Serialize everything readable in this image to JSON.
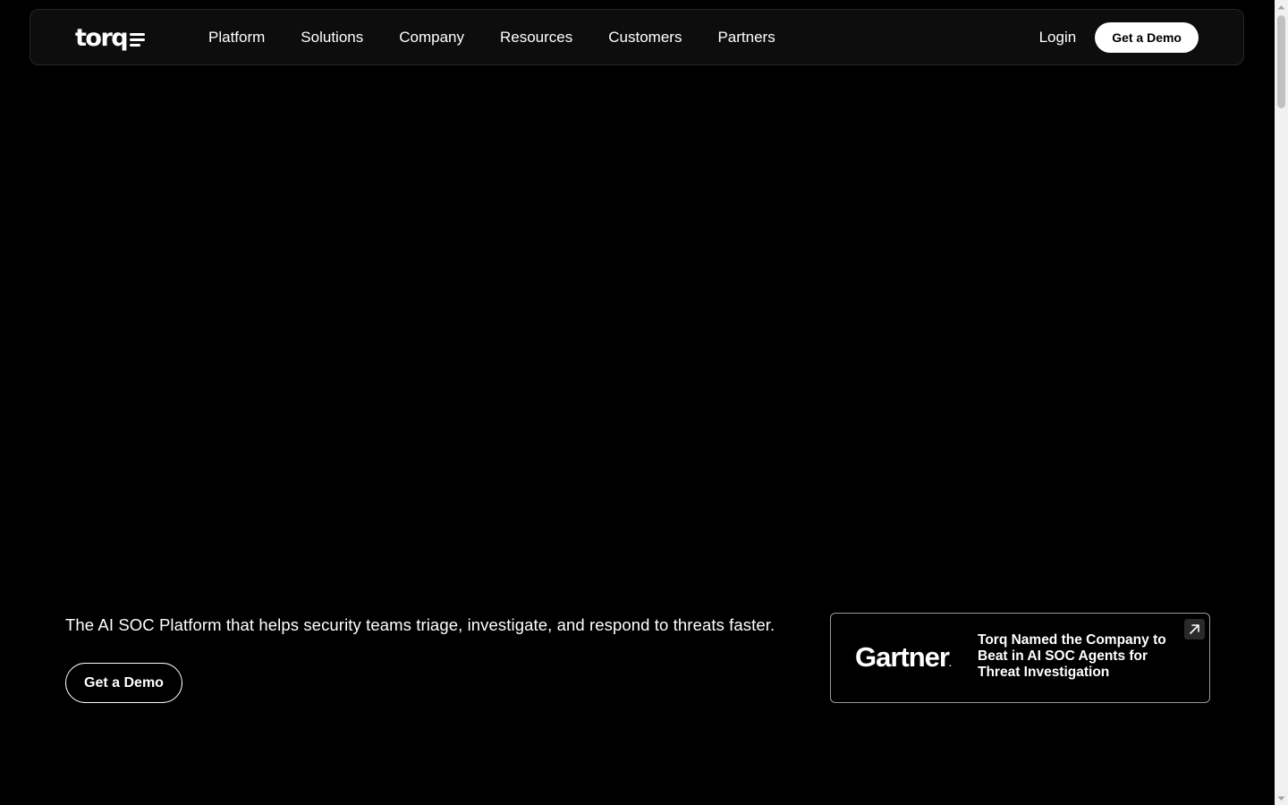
{
  "brand": {
    "logo_text": "torq",
    "logo_icon": "torq-logo-lines-icon"
  },
  "nav": {
    "links": [
      "Platform",
      "Solutions",
      "Company",
      "Resources",
      "Customers",
      "Partners"
    ],
    "login_label": "Login",
    "demo_label": "Get a Demo"
  },
  "hero": {
    "tagline": "The AI SOC Platform that helps security teams triage, investigate, and respond to threats faster.",
    "demo_label": "Get a Demo"
  },
  "gartner_card": {
    "logo_text": "Gartner",
    "logo_dot": ".",
    "headline": "Torq Named the Company to Beat in AI SOC Agents for Threat Investigation",
    "link_icon": "arrow-up-right-icon"
  },
  "colors": {
    "background": "#000000",
    "nav_background": "#0d0d0d",
    "accent": "#ffffff"
  }
}
